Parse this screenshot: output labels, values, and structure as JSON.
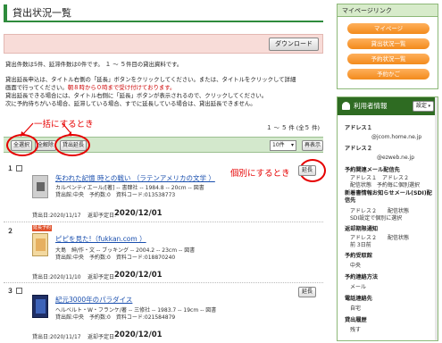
{
  "page": {
    "title": "貸出状況一覧",
    "download_label": "ダウンロード"
  },
  "summary": "貸出件数は5件、延滞件数は0件です。 １ ～ ５件目の貸出資料です。",
  "instructions": {
    "line1": "貸出延長申込は、タイトル右側の「延長」ボタンをクリックしてください。または、タイトルをクリックして詳細",
    "line2": "画面で行ってください。",
    "line2_red": "朝８時から０時まで受け付けております。",
    "line3": "貸出延長できる場合には、タイトル右側に「延長」ボタンが表示されるので、クリックしてください。",
    "line4": "次に予約待ちがいる場合、延滞している場合、すでに延長している場合は、貸出延長できません。"
  },
  "annotations": {
    "bulk": "一括にするとき",
    "individual": "個別にするとき"
  },
  "list": {
    "count": "１ ～ ５ 件 (全５ 件)",
    "actions": {
      "select_all": "全選択",
      "deselect_all": "全解除",
      "extend_loan": "貸出延長"
    },
    "per_page": "10件",
    "redisplay": "再表示"
  },
  "labels": {
    "lend_date_prefix": "貸出日:",
    "due_prefix": "返却予定日:",
    "extend": "延長",
    "badge": "延長予約"
  },
  "items": [
    {
      "num": "１",
      "title": "矢われた記憶 時との戦い （ラテンアメリカの文学 ）",
      "meta1": "カルペンティエール/[著] -- 書肆社 -- 1984.8 -- 20cm -- 図書",
      "meta2": "貸出館:中央　予約数:0　資料コード:013538773",
      "lend_date": "2020/11/17",
      "due": "2020/12/01"
    },
    {
      "num": "２",
      "title": "ピピを見た!（fukkan.com ）",
      "meta1": "大島　紳/作・文 -- ブッキング -- 2004.2 -- 23cm -- 図書",
      "meta2": "貸出館:中央　予約数:0　資料コード:018870240",
      "lend_date": "2020/11/10",
      "due": "2020/12/01"
    },
    {
      "num": "３",
      "title": "紀元3000年のパラダイス",
      "meta1": "ヘルベルト・W・フランケ/著 -- 三修社 -- 1983.7 -- 19cm -- 図書",
      "meta2": "貸出館:中央　予約数:0　資料コード:021584879",
      "lend_date": "2020/11/17",
      "due": "2020/12/01"
    }
  ],
  "sidebar": {
    "mypage_title": "マイページリンク",
    "links": [
      "マイページ",
      "貸出状況一覧",
      "予約状況一覧",
      "予約かご"
    ],
    "user_title": "利用者情報",
    "settings_label": "設定",
    "address1_label": "アドレス１",
    "address1_value": "@jcom.home.ne.jp",
    "address2_label": "アドレス２",
    "address2_value": "@ezweb.ne.jp",
    "reserve_mail_label": "予約関連メール配信先",
    "reserve_mail_values": "アドレス１　アドレス２",
    "reserve_mail_status": "配信状態　予約毎に個別選択",
    "sdi_label": "新着書情報お知らせメール(SDI)配信先",
    "sdi_value": "アドレス２　　配信状態",
    "sdi_status": "SDI設定で個別に選択",
    "return_label": "返却期限通知",
    "return_value": "アドレス２　　配信状態",
    "return_status": "前 3日前",
    "pickup_label": "予約受取館",
    "pickup_value": "中央",
    "contact_label": "予約連絡方法",
    "contact_value": "メール",
    "phone_label": "電話連絡先",
    "phone_value": "自宅",
    "history_label": "貸出履歴",
    "history_value": "残す"
  },
  "colors": {
    "accent_green": "#2e8b3c",
    "annotation_red": "#e60000",
    "link_orange": "#f28a1c"
  }
}
